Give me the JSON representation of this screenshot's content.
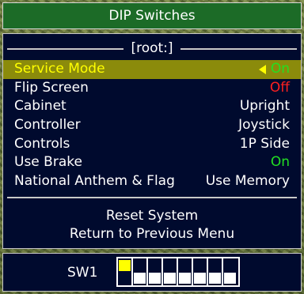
{
  "title": "DIP Switches",
  "menu_header": "[root:]",
  "menu_items": [
    {
      "label": "Service Mode",
      "value": "On",
      "color": "#22e022",
      "selected": true
    },
    {
      "label": "Flip Screen",
      "value": "Off",
      "color": "#ff2020",
      "selected": false
    },
    {
      "label": "Cabinet",
      "value": "Upright",
      "color": "#ffffff",
      "selected": false
    },
    {
      "label": "Controller",
      "value": "Joystick",
      "color": "#ffffff",
      "selected": false
    },
    {
      "label": "Controls",
      "value": "1P Side",
      "color": "#ffffff",
      "selected": false
    },
    {
      "label": "Use Brake",
      "value": "On",
      "color": "#22e022",
      "selected": false
    },
    {
      "label": "National Anthem & Flag",
      "value": "Use Memory",
      "color": "#ffffff",
      "selected": false
    }
  ],
  "actions": {
    "reset": "Reset System",
    "return": "Return to Previous Menu"
  },
  "switch_bank": {
    "label": "SW1",
    "switches": [
      "on",
      "off",
      "off",
      "off",
      "off",
      "off",
      "off",
      "off"
    ]
  },
  "colors": {
    "title_bg": "#1c6b27",
    "panel_bg": "#000a2e",
    "highlight_bg": "#8b8b0b",
    "highlight_text": "#ffff00",
    "on_green": "#22e022",
    "off_red": "#ff2020"
  }
}
